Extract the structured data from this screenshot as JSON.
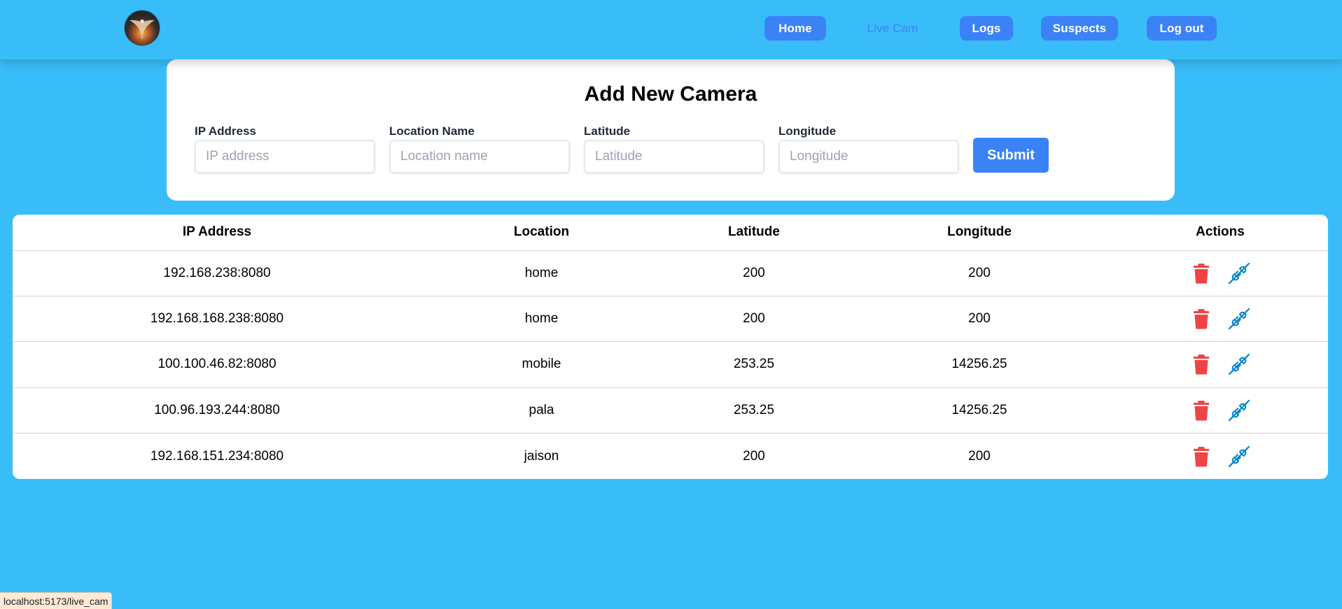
{
  "nav": {
    "logo_icon": "eagle-logo-icon",
    "links": [
      {
        "label": "Home",
        "active": false
      },
      {
        "label": "Live Cam",
        "active": true
      },
      {
        "label": "Logs",
        "active": false
      },
      {
        "label": "Suspects",
        "active": false
      },
      {
        "label": "Log out",
        "active": false
      }
    ]
  },
  "form": {
    "title": "Add New Camera",
    "fields": [
      {
        "label": "IP Address",
        "placeholder": "IP address",
        "value": ""
      },
      {
        "label": "Location Name",
        "placeholder": "Location name",
        "value": ""
      },
      {
        "label": "Latitude",
        "placeholder": "Latitude",
        "value": ""
      },
      {
        "label": "Longitude",
        "placeholder": "Longitude",
        "value": ""
      }
    ],
    "submit_label": "Submit"
  },
  "table": {
    "headers": [
      "IP Address",
      "Location",
      "Latitude",
      "Longitude",
      "Actions"
    ],
    "rows": [
      {
        "ip": "192.168.238:8080",
        "location": "home",
        "latitude": "200",
        "longitude": "200"
      },
      {
        "ip": "192.168.168.238:8080",
        "location": "home",
        "latitude": "200",
        "longitude": "200"
      },
      {
        "ip": "100.100.46.82:8080",
        "location": "mobile",
        "latitude": "253.25",
        "longitude": "14256.25"
      },
      {
        "ip": "100.96.193.244:8080",
        "location": "pala",
        "latitude": "253.25",
        "longitude": "14256.25"
      },
      {
        "ip": "192.168.151.234:8080",
        "location": "jaison",
        "latitude": "200",
        "longitude": "200"
      }
    ],
    "action_icons": [
      "trash-icon",
      "disconnect-plug-icon"
    ]
  },
  "status_bar": {
    "url": "localhost:5173/live_cam"
  },
  "colors": {
    "background": "#38bdf8",
    "primary": "#3b82f6",
    "delete": "#ef4444",
    "disconnect": "#0284c7"
  }
}
